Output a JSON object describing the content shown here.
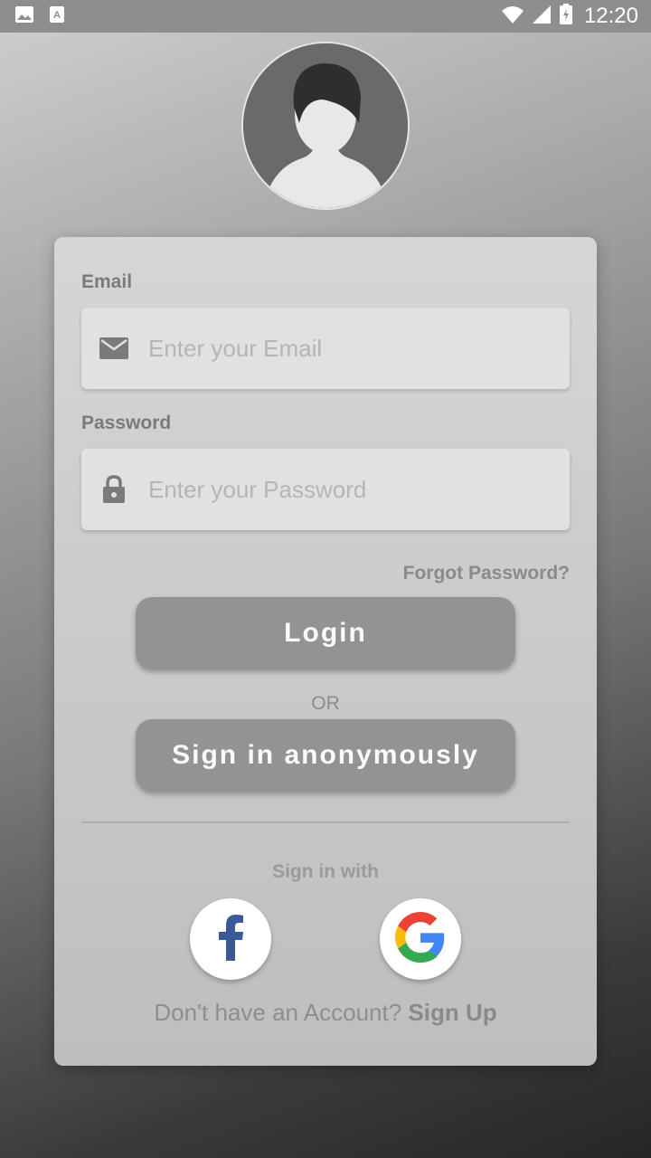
{
  "status_bar": {
    "time": "12:20",
    "icons": [
      "image-icon",
      "font-icon",
      "wifi-icon",
      "signal-icon",
      "battery-icon"
    ]
  },
  "avatar": {
    "icon": "user-avatar-icon"
  },
  "form": {
    "email_label": "Email",
    "email_placeholder": "Enter your Email",
    "email_icon": "mail-icon",
    "password_label": "Password",
    "password_placeholder": "Enter your Password",
    "password_icon": "lock-icon",
    "forgot_label": "Forgot Password?",
    "login_label": "Login",
    "or_label": "OR",
    "anon_label": "Sign in anonymously",
    "signin_with_label": "Sign in with",
    "social": [
      "facebook-icon",
      "google-icon"
    ],
    "no_account_text": "Don't have an Account?",
    "signup_label": "Sign Up"
  },
  "colors": {
    "button": "#939393",
    "card": "#cfcfcf",
    "facebook": "#3b5998"
  }
}
